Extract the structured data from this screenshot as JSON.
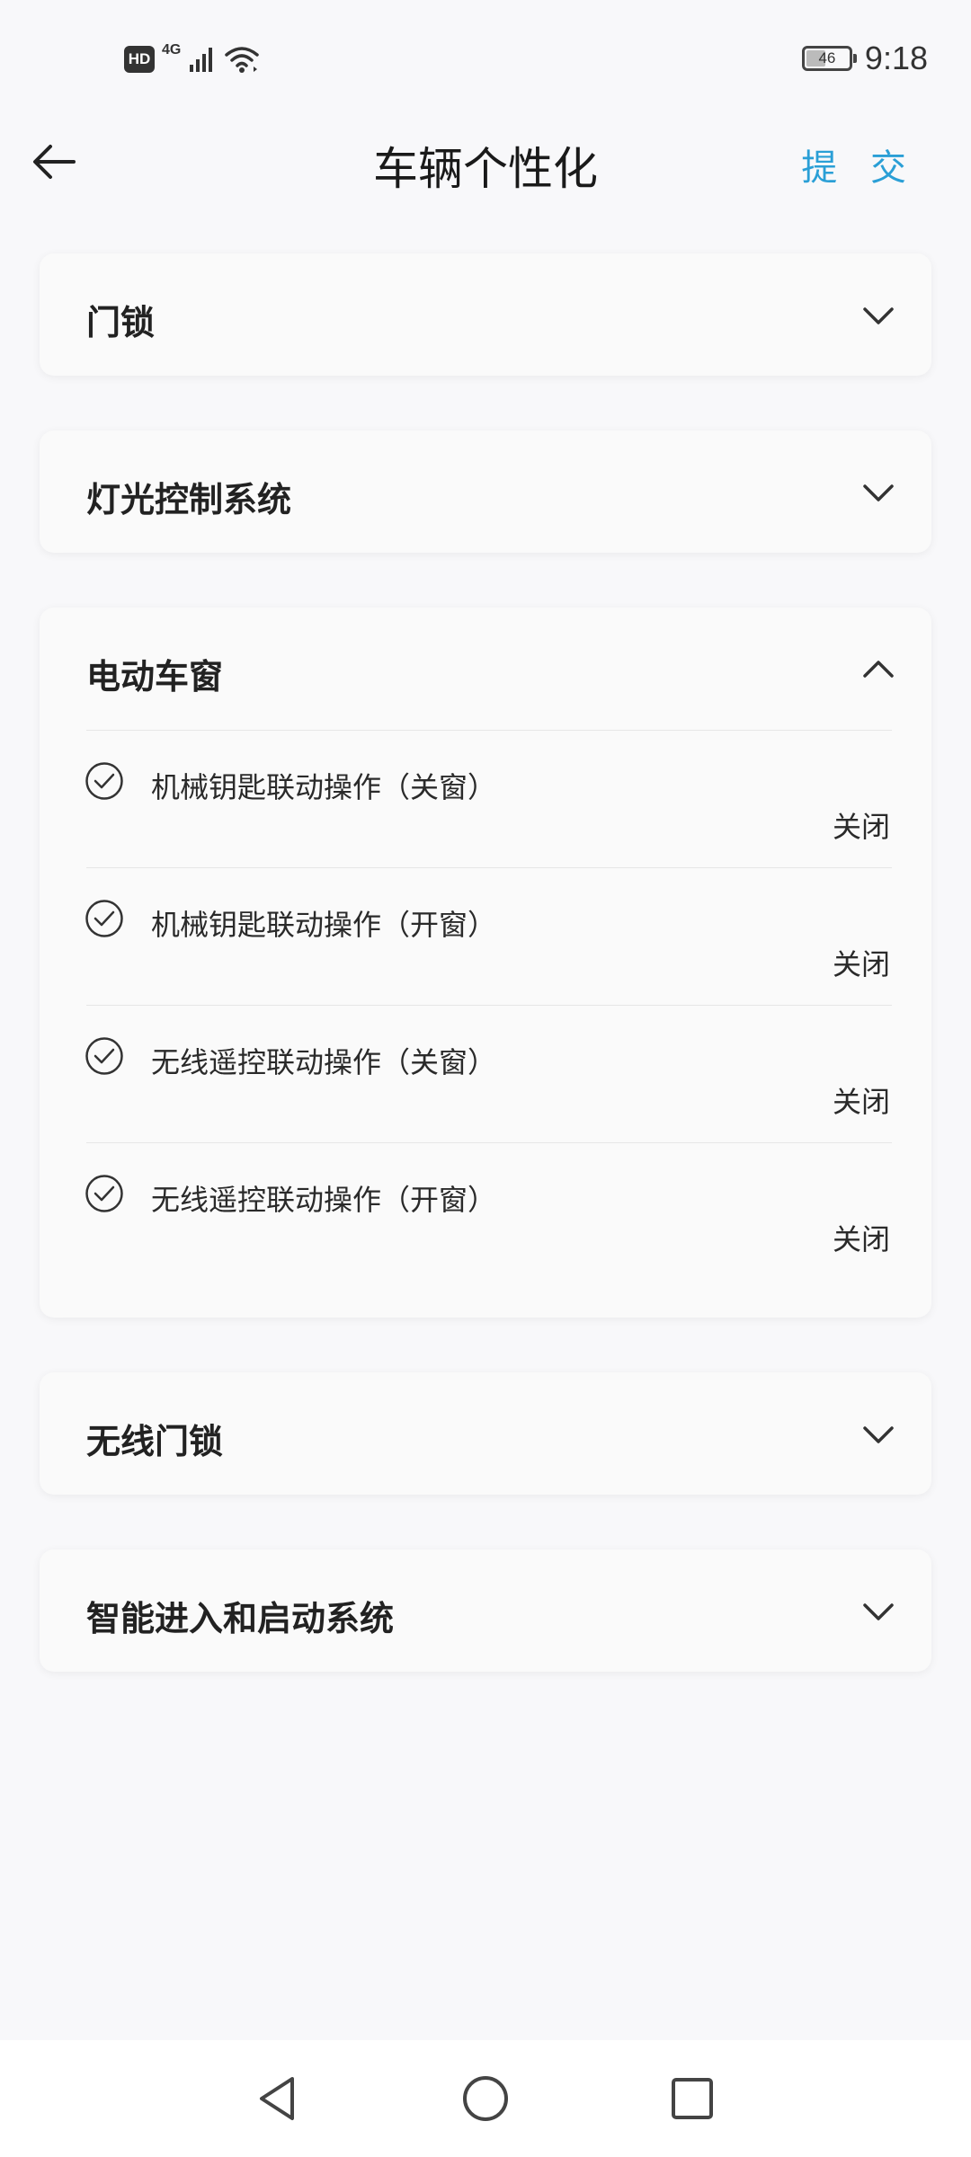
{
  "status_bar": {
    "hd_label": "HD",
    "network_label": "4G",
    "battery_level": "46",
    "battery_fraction": 0.46,
    "time": "9:18",
    "icons": [
      "hd-icon",
      "signal-icon",
      "wifi-icon",
      "battery-icon"
    ]
  },
  "header": {
    "title": "车辆个性化",
    "submit_label": "提 交",
    "back_icon": "arrow-left-icon"
  },
  "sections": [
    {
      "title": "门锁",
      "expanded": false
    },
    {
      "title": "灯光控制系统",
      "expanded": false
    },
    {
      "title": "电动车窗",
      "expanded": true,
      "options": [
        {
          "label": "机械钥匙联动操作（关窗）",
          "value": "关闭"
        },
        {
          "label": "机械钥匙联动操作（开窗）",
          "value": "关闭"
        },
        {
          "label": "无线遥控联动操作（关窗）",
          "value": "关闭"
        },
        {
          "label": "无线遥控联动操作（开窗）",
          "value": "关闭"
        }
      ]
    },
    {
      "title": "无线门锁",
      "expanded": false
    },
    {
      "title": "智能进入和启动系统",
      "expanded": false
    }
  ],
  "colors": {
    "accent": "#2a9fd6",
    "background": "#f8f8fa",
    "card": "#fafafa",
    "text": "#222222"
  },
  "nav_bar": {
    "icons": [
      "back-triangle-icon",
      "home-circle-icon",
      "recents-square-icon"
    ]
  }
}
